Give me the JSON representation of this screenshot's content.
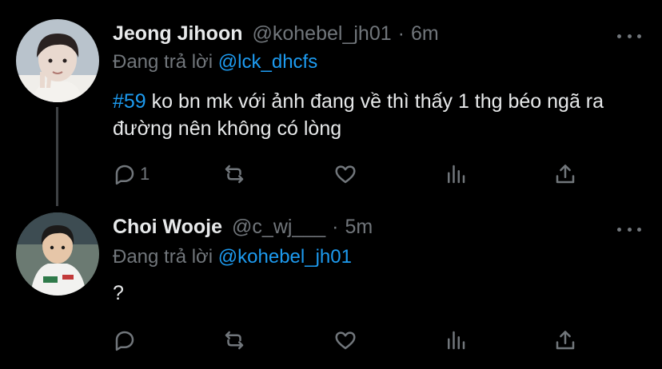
{
  "tweets": [
    {
      "name": "Jeong Jihoon",
      "handle": "@kohebel_jh01",
      "separator": "·",
      "time": "6m",
      "reply_prefix": "Đang trả lời",
      "reply_to": "@lck_dhcfs",
      "hashtag": "#59",
      "text": " ko bn mk với ảnh đang về thì thấy 1 thg béo ngã ra đường nên không có lòng",
      "reply_count": "1",
      "avatar_icon": "profile-photo",
      "colors": {
        "skin": "#e9d9cf",
        "hair": "#2a2221",
        "bg": "#b9c3cc"
      }
    },
    {
      "name": "Choi Wooje",
      "handle": "@c_wj___",
      "separator": "·",
      "time": "5m",
      "reply_prefix": "Đang trả lời",
      "reply_to": "@kohebel_jh01",
      "hashtag": "",
      "text": "?",
      "reply_count": "",
      "avatar_icon": "profile-photo",
      "colors": {
        "skin": "#e6c6a8",
        "hair": "#1c1a19",
        "bg": "#6b7a72"
      }
    }
  ],
  "icons": {
    "reply": "reply-icon",
    "retweet": "retweet-icon",
    "like": "heart-icon",
    "views": "analytics-icon",
    "share": "share-icon",
    "more": "more-icon"
  },
  "colors": {
    "background": "#000000",
    "text": "#e7e9ea",
    "muted": "#71767b",
    "accent": "#1d9bf0",
    "thread_line": "#3e4144"
  }
}
